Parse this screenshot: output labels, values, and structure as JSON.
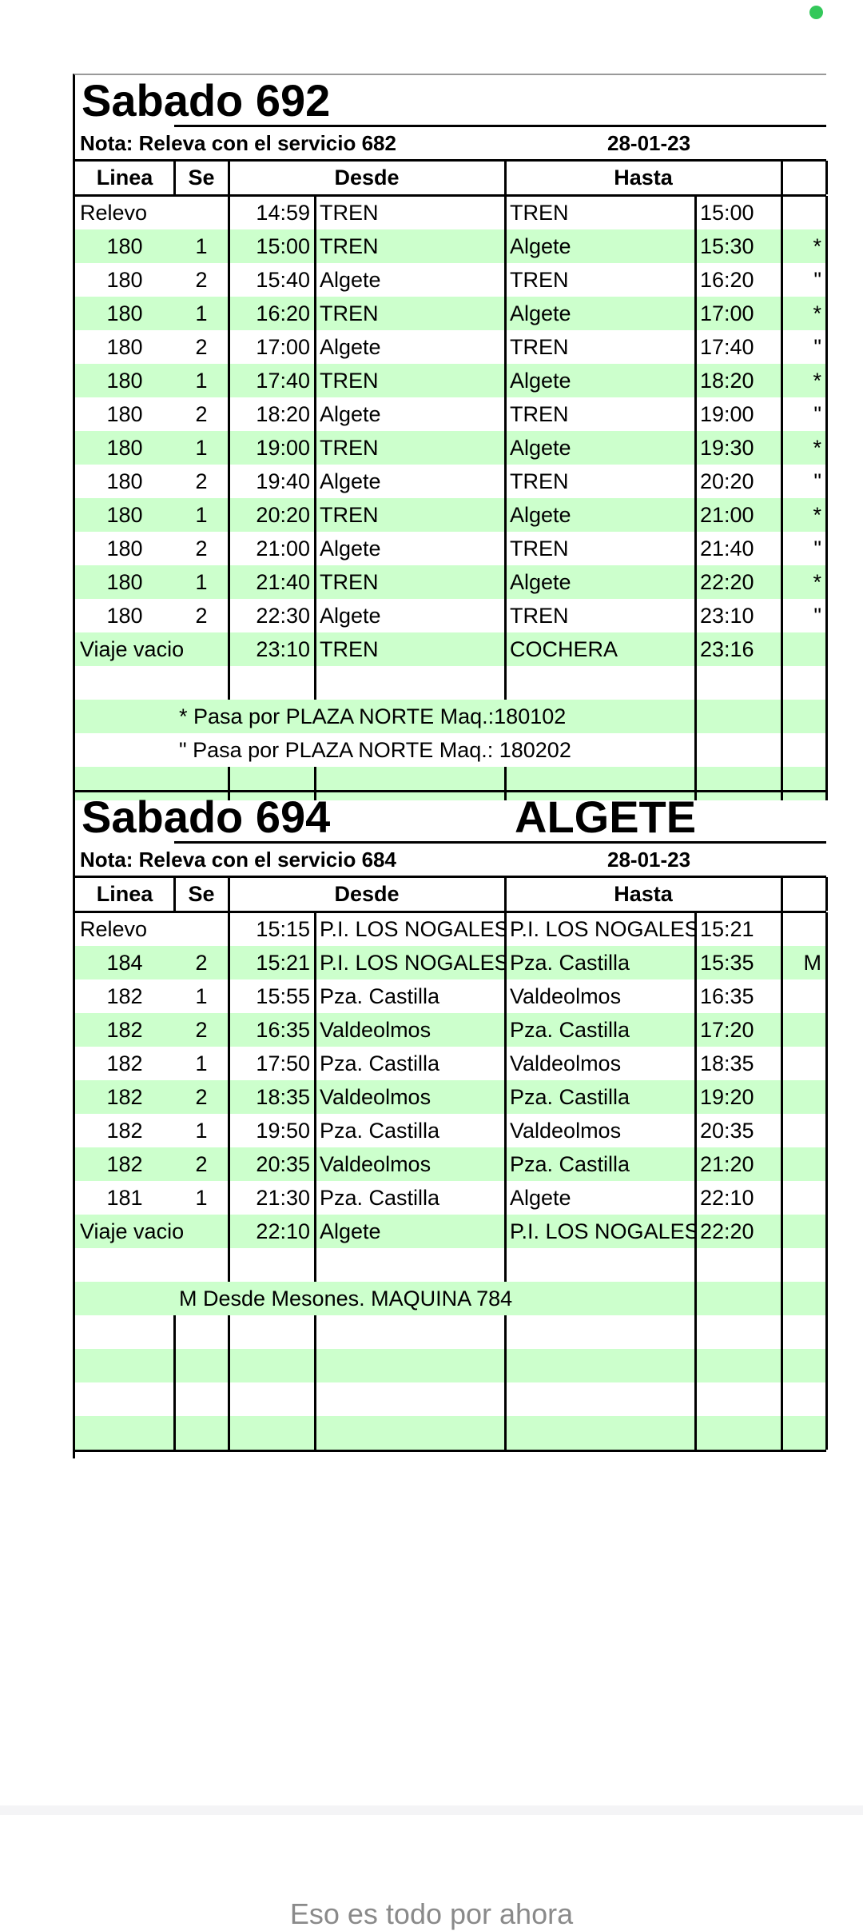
{
  "status": {
    "indicator_color": "#33c85a"
  },
  "block1": {
    "title": "Sabado 692",
    "place": "",
    "note": "Nota: Releva con el servicio 682",
    "date": "28-01-23",
    "headers": {
      "linea": "Linea",
      "se": "Se",
      "desde": "Desde",
      "hasta": "Hasta"
    },
    "rows": [
      {
        "linea": "Relevo",
        "se": "",
        "t1": "14:59",
        "from": "TREN",
        "to": "TREN",
        "t2": "15:00",
        "mark": ""
      },
      {
        "linea": "180",
        "se": "1",
        "t1": "15:00",
        "from": "TREN",
        "to": "Algete",
        "t2": "15:30",
        "mark": "*"
      },
      {
        "linea": "180",
        "se": "2",
        "t1": "15:40",
        "from": "Algete",
        "to": "TREN",
        "t2": "16:20",
        "mark": "\""
      },
      {
        "linea": "180",
        "se": "1",
        "t1": "16:20",
        "from": "TREN",
        "to": "Algete",
        "t2": "17:00",
        "mark": "*"
      },
      {
        "linea": "180",
        "se": "2",
        "t1": "17:00",
        "from": "Algete",
        "to": "TREN",
        "t2": "17:40",
        "mark": "\""
      },
      {
        "linea": "180",
        "se": "1",
        "t1": "17:40",
        "from": "TREN",
        "to": "Algete",
        "t2": "18:20",
        "mark": "*"
      },
      {
        "linea": "180",
        "se": "2",
        "t1": "18:20",
        "from": "Algete",
        "to": "TREN",
        "t2": "19:00",
        "mark": "\""
      },
      {
        "linea": "180",
        "se": "1",
        "t1": "19:00",
        "from": "TREN",
        "to": "Algete",
        "t2": "19:30",
        "mark": "*"
      },
      {
        "linea": "180",
        "se": "2",
        "t1": "19:40",
        "from": "Algete",
        "to": "TREN",
        "t2": "20:20",
        "mark": "\""
      },
      {
        "linea": "180",
        "se": "1",
        "t1": "20:20",
        "from": "TREN",
        "to": "Algete",
        "t2": "21:00",
        "mark": "*"
      },
      {
        "linea": "180",
        "se": "2",
        "t1": "21:00",
        "from": "Algete",
        "to": "TREN",
        "t2": "21:40",
        "mark": "\""
      },
      {
        "linea": "180",
        "se": "1",
        "t1": "21:40",
        "from": "TREN",
        "to": "Algete",
        "t2": "22:20",
        "mark": "*"
      },
      {
        "linea": "180",
        "se": "2",
        "t1": "22:30",
        "from": "Algete",
        "to": "TREN",
        "t2": "23:10",
        "mark": "\""
      },
      {
        "linea": "Viaje vacio",
        "se": "",
        "t1": "23:10",
        "from": "TREN",
        "to": "COCHERA",
        "t2": "23:16",
        "mark": ""
      }
    ],
    "footnotes": [
      "* Pasa por PLAZA NORTE Maq.:180102",
      "\" Pasa por PLAZA NORTE Maq.: 180202"
    ]
  },
  "block2": {
    "title": "Sabado 694",
    "place": "ALGETE",
    "note": "Nota: Releva con el servicio 684",
    "date": "28-01-23",
    "headers": {
      "linea": "Linea",
      "se": "Se",
      "desde": "Desde",
      "hasta": "Hasta"
    },
    "rows": [
      {
        "linea": "Relevo",
        "se": "",
        "t1": "15:15",
        "from": "P.I. LOS NOGALES",
        "to": "P.I. LOS NOGALES",
        "t2": "15:21",
        "mark": ""
      },
      {
        "linea": "184",
        "se": "2",
        "t1": "15:21",
        "from": "P.I. LOS NOGALES",
        "to": "Pza. Castilla",
        "t2": "15:35",
        "mark": "M"
      },
      {
        "linea": "182",
        "se": "1",
        "t1": "15:55",
        "from": "Pza. Castilla",
        "to": "Valdeolmos",
        "t2": "16:35",
        "mark": ""
      },
      {
        "linea": "182",
        "se": "2",
        "t1": "16:35",
        "from": "Valdeolmos",
        "to": "Pza. Castilla",
        "t2": "17:20",
        "mark": ""
      },
      {
        "linea": "182",
        "se": "1",
        "t1": "17:50",
        "from": "Pza. Castilla",
        "to": "Valdeolmos",
        "t2": "18:35",
        "mark": ""
      },
      {
        "linea": "182",
        "se": "2",
        "t1": "18:35",
        "from": "Valdeolmos",
        "to": "Pza. Castilla",
        "t2": "19:20",
        "mark": ""
      },
      {
        "linea": "182",
        "se": "1",
        "t1": "19:50",
        "from": "Pza. Castilla",
        "to": "Valdeolmos",
        "t2": "20:35",
        "mark": ""
      },
      {
        "linea": "182",
        "se": "2",
        "t1": "20:35",
        "from": "Valdeolmos",
        "to": "Pza. Castilla",
        "t2": "21:20",
        "mark": ""
      },
      {
        "linea": "181",
        "se": "1",
        "t1": "21:30",
        "from": "Pza. Castilla",
        "to": "Algete",
        "t2": "22:10",
        "mark": ""
      },
      {
        "linea": "Viaje vacio",
        "se": "",
        "t1": "22:10",
        "from": "Algete",
        "to": "P.I. LOS NOGALES",
        "t2": "22:20",
        "mark": ""
      }
    ],
    "footnotes": [
      "M Desde Mesones. MAQUINA 784"
    ]
  },
  "footer": {
    "message": "Eso es todo por ahora"
  }
}
